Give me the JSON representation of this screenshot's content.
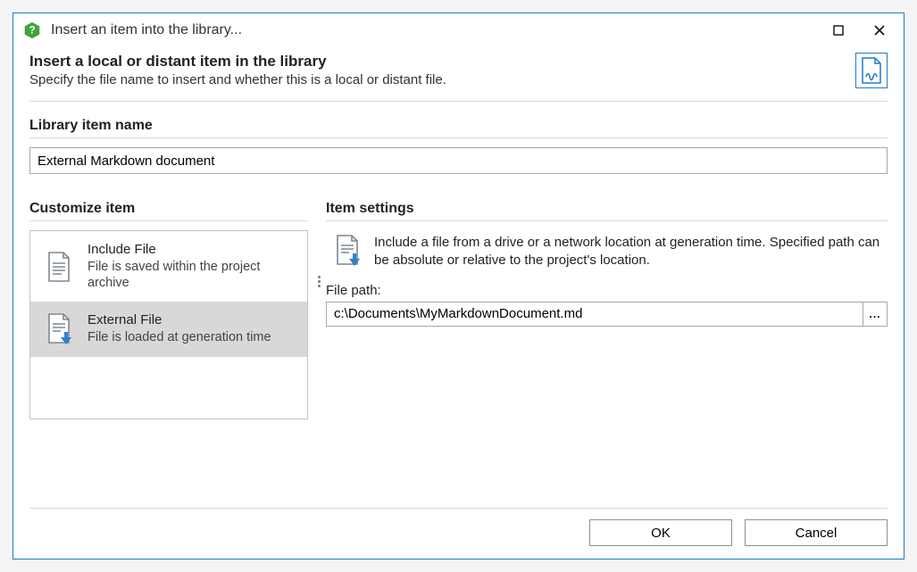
{
  "window": {
    "title": "Insert an item into the library..."
  },
  "header": {
    "title": "Insert a local or distant item in the library",
    "subtitle": "Specify the file name to insert and whether this is a local or distant file."
  },
  "name_section": {
    "label": "Library item name",
    "value": "External Markdown document"
  },
  "customize": {
    "label": "Customize item",
    "options": [
      {
        "title": "Include File",
        "desc": "File is saved within the project archive",
        "selected": false
      },
      {
        "title": "External File",
        "desc": "File is loaded at generation time",
        "selected": true
      }
    ]
  },
  "settings": {
    "label": "Item settings",
    "description": "Include a file from a drive or a network location at generation time. Specified path can be absolute or relative to the project's location.",
    "path_label": "File path:",
    "path_value": "c:\\Documents\\MyMarkdownDocument.md",
    "browse_label": "..."
  },
  "buttons": {
    "ok": "OK",
    "cancel": "Cancel"
  }
}
